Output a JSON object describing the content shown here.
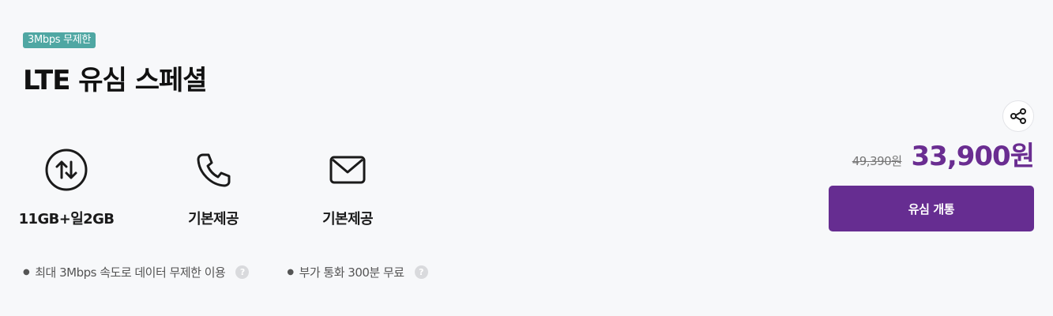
{
  "plan": {
    "badge": "3Mbps 무제한",
    "title": "LTE 유심 스페셜"
  },
  "features": [
    {
      "icon": "data-transfer-icon",
      "label": "11GB+일2GB"
    },
    {
      "icon": "phone-icon",
      "label": "기본제공"
    },
    {
      "icon": "mail-icon",
      "label": "기본제공"
    }
  ],
  "notes": [
    {
      "text": "최대 3Mbps 속도로 데이터 무제한 이용",
      "help": "?"
    },
    {
      "text": "부가 통화 300분 무료",
      "help": "?"
    }
  ],
  "pricing": {
    "original": "49,390원",
    "sale": "33,900원"
  },
  "actions": {
    "share_icon": "share-icon",
    "cta_label": "유심 개통"
  },
  "colors": {
    "badge": "#4fa7a3",
    "accent": "#662d91",
    "background": "#f7f8fa"
  }
}
